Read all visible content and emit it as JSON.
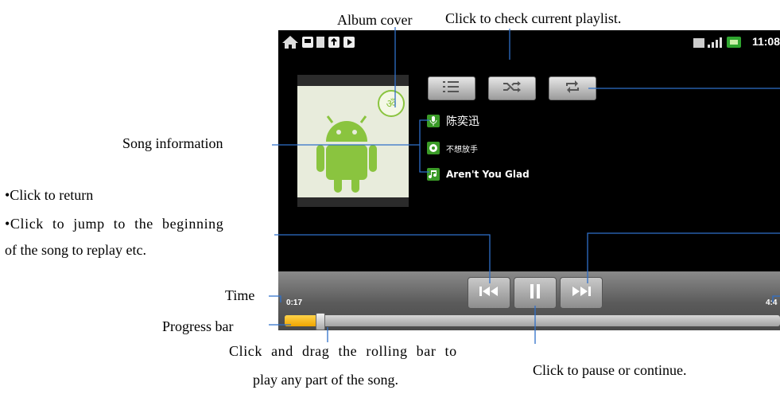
{
  "annotations": {
    "album_cover": "Album cover",
    "check_playlist": "Click to check current playlist.",
    "song_information": "Song  information",
    "click_return": "•Click to return",
    "jump_line1": "•Click  to  jump  to  the  beginning",
    "jump_line2": "of the song to replay etc.",
    "time": "Time",
    "progress_bar": "Progress bar",
    "drag_line1": "Click  and  drag  the  rolling  bar  to",
    "drag_line2": "play any part of the song.",
    "pause_continue": "Click to pause or continue."
  },
  "player": {
    "status_time": "11:08",
    "artist": "陈奕迅",
    "album": "不想放手",
    "title": "Aren't You Glad",
    "elapsed": "0:17",
    "total": "4:4",
    "progress_fraction": 0.07
  },
  "colors": {
    "annotation_line": "#2f6fc9",
    "android_green": "#8ac43f",
    "progress_fill": "#f5b800"
  },
  "icons": [
    "home-icon",
    "sd-card-icon",
    "usb-icon",
    "media-icon",
    "signal-icon",
    "battery-icon",
    "playlist-icon",
    "shuffle-icon",
    "repeat-icon",
    "previous-icon",
    "pause-icon",
    "next-icon"
  ]
}
